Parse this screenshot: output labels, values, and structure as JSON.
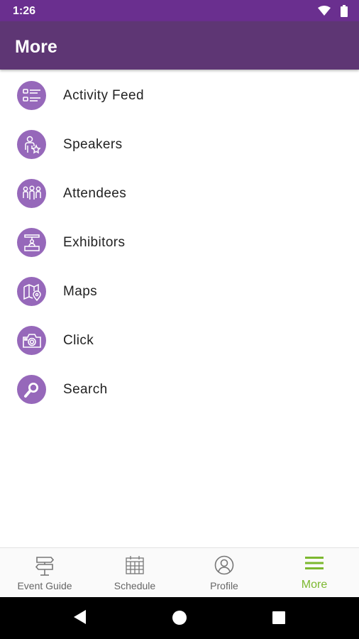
{
  "status_bar": {
    "time": "1:26"
  },
  "app_bar": {
    "title": "More"
  },
  "menu": {
    "items": [
      {
        "label": "Activity Feed",
        "icon": "activity-feed-icon"
      },
      {
        "label": "Speakers",
        "icon": "speakers-icon"
      },
      {
        "label": "Attendees",
        "icon": "attendees-icon"
      },
      {
        "label": "Exhibitors",
        "icon": "exhibitors-icon"
      },
      {
        "label": "Maps",
        "icon": "maps-icon"
      },
      {
        "label": "Click",
        "icon": "camera-icon"
      },
      {
        "label": "Search",
        "icon": "search-icon"
      }
    ]
  },
  "bottom_nav": {
    "tabs": [
      {
        "label": "Event Guide",
        "icon": "signpost-icon",
        "active": false
      },
      {
        "label": "Schedule",
        "icon": "calendar-icon",
        "active": false
      },
      {
        "label": "Profile",
        "icon": "profile-icon",
        "active": false
      },
      {
        "label": "More",
        "icon": "menu-icon",
        "active": true
      }
    ]
  },
  "colors": {
    "status_bar": "#6a2f8f",
    "app_bar": "#5e3674",
    "menu_icon_bg": "#9668ba",
    "active_tab": "#7cb82f",
    "inactive_tab": "#666666"
  }
}
